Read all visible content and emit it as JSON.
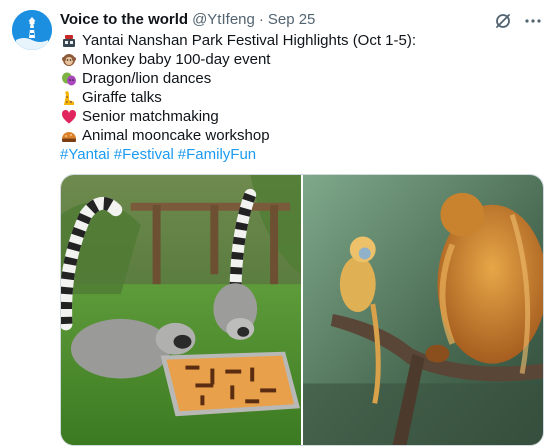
{
  "author": {
    "display_name": "Voice to the world",
    "handle": "@YtIfeng",
    "separator": "·",
    "date": "Sep 25"
  },
  "body": {
    "title": "Yantai Nanshan Park Festival Highlights (Oct 1-5):",
    "items": [
      {
        "icon": "monkey-emoji",
        "text": "Monkey baby 100-day event"
      },
      {
        "icon": "masks-emoji",
        "text": "Dragon/lion dances"
      },
      {
        "icon": "giraffe-emoji",
        "text": "Giraffe talks"
      },
      {
        "icon": "red-heart-emoji",
        "text": "Senior matchmaking"
      },
      {
        "icon": "mooncake-emoji",
        "text": "Animal mooncake workshop"
      }
    ],
    "hashtags": [
      "#Yantai",
      "#Festival",
      "#FamilyFun"
    ]
  },
  "media": [
    {
      "icon": "lemur-photo"
    },
    {
      "icon": "golden-monkey-photo"
    }
  ],
  "colors": {
    "link": "#1d9bf0",
    "muted": "#536471",
    "text": "#0f1419",
    "avatar": "#1d8fe0"
  }
}
